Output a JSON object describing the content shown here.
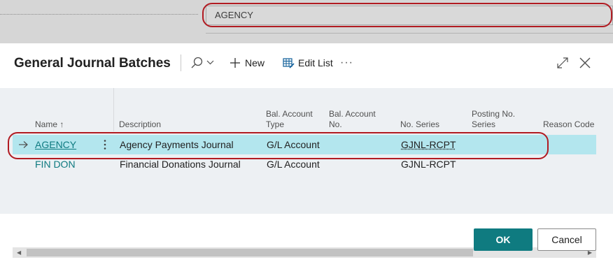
{
  "background": {
    "field_value": "AGENCY"
  },
  "dialog": {
    "title": "General Journal Batches",
    "toolbar": {
      "search_icon": "search-icon",
      "new_label": "New",
      "edit_list_label": "Edit List",
      "more_label": "···"
    },
    "columns": [
      {
        "label": "Name",
        "sort": "↑"
      },
      {
        "label": "Description"
      },
      {
        "label": "Bal. Account\nType"
      },
      {
        "label": "Bal. Account\nNo."
      },
      {
        "label": "No. Series"
      },
      {
        "label": "Posting No.\nSeries"
      },
      {
        "label": "Reason Code"
      }
    ],
    "rows": [
      {
        "selected": true,
        "name": "AGENCY",
        "description": "Agency Payments Journal",
        "bal_account_type": "G/L Account",
        "bal_account_no": "",
        "no_series": "GJNL-RCPT",
        "posting_no_series": "",
        "reason_code": ""
      },
      {
        "selected": false,
        "name": "FIN DON",
        "description": "Financial Donations Journal",
        "bal_account_type": "G/L Account",
        "bal_account_no": "",
        "no_series": "GJNL-RCPT",
        "posting_no_series": "",
        "reason_code": ""
      }
    ],
    "buttons": {
      "ok": "OK",
      "cancel": "Cancel"
    }
  },
  "colors": {
    "accent": "#0f7b80",
    "selected_row": "#b3e6ee",
    "highlight": "#b11b22"
  }
}
